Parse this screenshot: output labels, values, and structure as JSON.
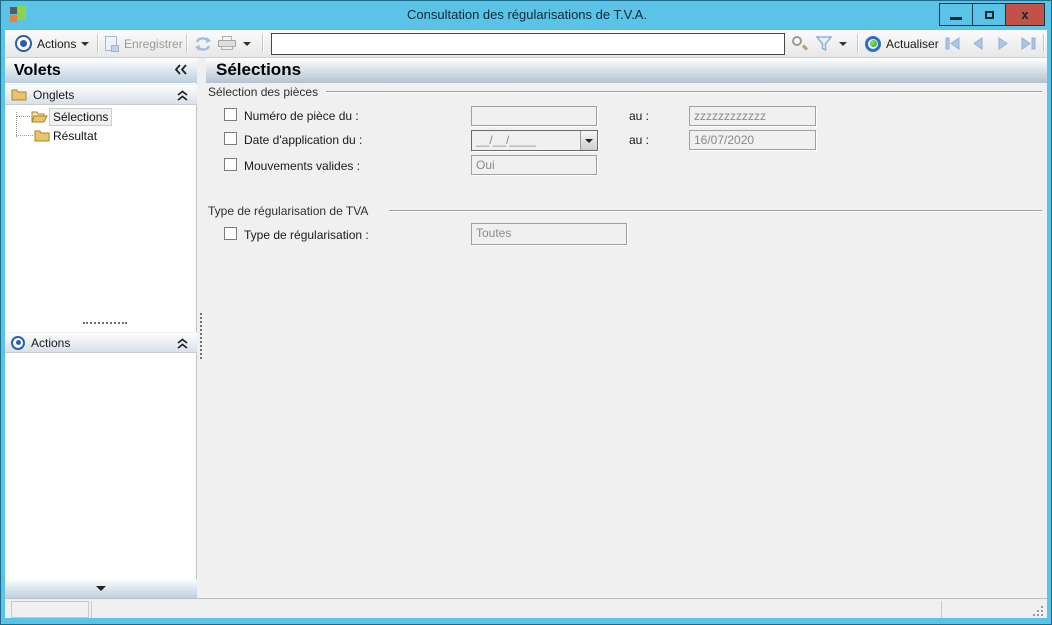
{
  "window": {
    "title": "Consultation des régularisations de  T.V.A.",
    "controls": {
      "minimize": "–",
      "maximize": "",
      "close": "x"
    }
  },
  "colors": {
    "titlebar_blue": "#5bc4e6",
    "close_red": "#c25248",
    "header_gradient_end": "#b3c2d0",
    "accent_blue": "#2a5fa8",
    "disabled_text": "#8a8a8a"
  },
  "toolbar": {
    "actions_label": "Actions",
    "save_label": "Enregistrer",
    "search_value": "",
    "actualiser_label": "Actualiser"
  },
  "sidebar": {
    "title": "Volets",
    "onglets_label": "Onglets",
    "tree": [
      {
        "label": "Sélections",
        "selected": true
      },
      {
        "label": "Résultat",
        "selected": false
      }
    ],
    "actions_label": "Actions"
  },
  "main": {
    "title": "Sélections",
    "sections": [
      {
        "title": "Sélection des pièces"
      },
      {
        "title": "Type de régularisation de TVA"
      }
    ],
    "rows": [
      {
        "label": "Numéro de pièce du :",
        "value": "",
        "au_label": "au :",
        "au_value": "zzzzzzzzzzzz"
      },
      {
        "label": "Date d'application du :",
        "value": "__/__/____",
        "au_label": "au :",
        "au_value": "16/07/2020"
      },
      {
        "label": "Mouvements valides :",
        "value": "Oui"
      },
      {
        "label": "Type de régularisation :",
        "value": "Toutes"
      }
    ]
  },
  "statusbar": {
    "cell1": "",
    "cell2": "",
    "cell3": ""
  }
}
